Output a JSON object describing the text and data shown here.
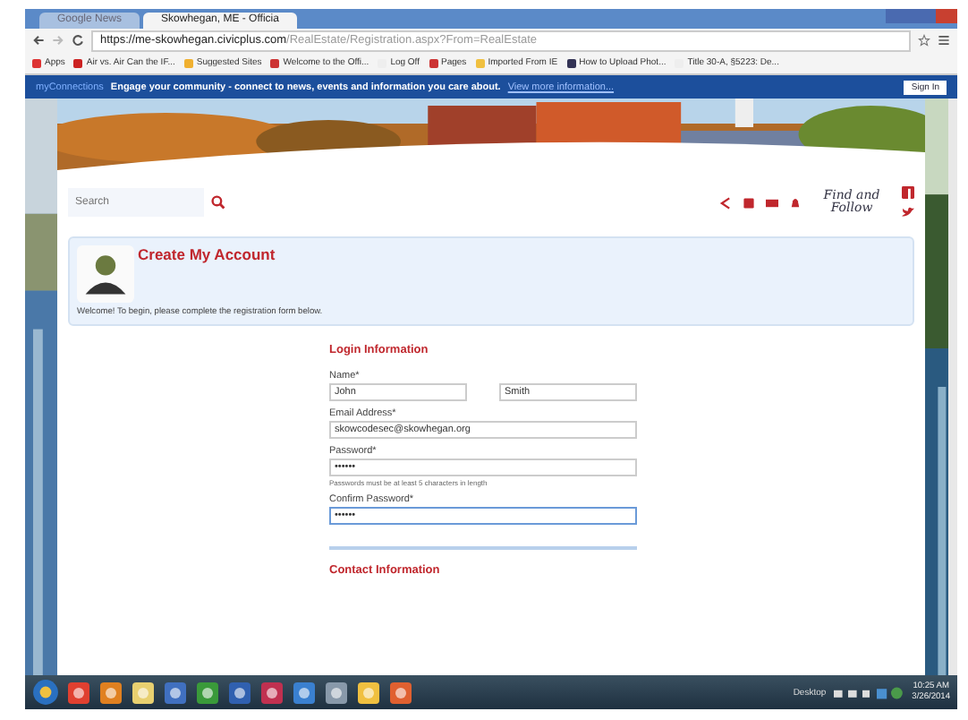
{
  "browser": {
    "tabs": [
      {
        "title": "Google News",
        "selected": false
      },
      {
        "title": "Skowhegan, ME - Officia",
        "selected": true
      }
    ],
    "url_host": "https://me-skowhegan.civicplus.com",
    "url_path": "/RealEstate/Registration.aspx?From=RealEstate",
    "bookmarks": [
      "Apps",
      "Air vs. Air Can the IF...",
      "Suggested Sites",
      "Welcome to the Offi...",
      "Log Off",
      "Pages",
      "Imported From IE",
      "How to Upload Phot...",
      "Title 30-A, §5223: De..."
    ]
  },
  "banner": {
    "brand": "myConnections",
    "message": "Engage your community - connect to news, events and information you care about.",
    "link": "View more information...",
    "sign_in": "Sign In"
  },
  "header": {
    "search": {
      "placeholder": "Search"
    },
    "follow": "Find and Follow"
  },
  "account_card": {
    "title": "Create My Account",
    "welcome": "Welcome! To begin, please complete the registration form below."
  },
  "form": {
    "sections": [
      {
        "heading": "Login Information",
        "fields": [
          {
            "label": "Name*",
            "values": [
              "John",
              "Smith"
            ],
            "focused": false
          },
          {
            "label": "Email Address*",
            "values": [
              "skowcodesec@skowhegan.org"
            ],
            "focused": false
          },
          {
            "label": "Password*",
            "values": [
              "••••••"
            ],
            "focused": false,
            "hint": "Passwords must be at least 5 characters in length"
          },
          {
            "label": "Confirm Password*",
            "values": [
              "••••••"
            ],
            "focused": true
          }
        ]
      },
      {
        "heading": "Contact Information"
      }
    ]
  },
  "taskbar": {
    "desktop": "Desktop",
    "time": "10:25 AM",
    "date": "3/26/2014"
  }
}
